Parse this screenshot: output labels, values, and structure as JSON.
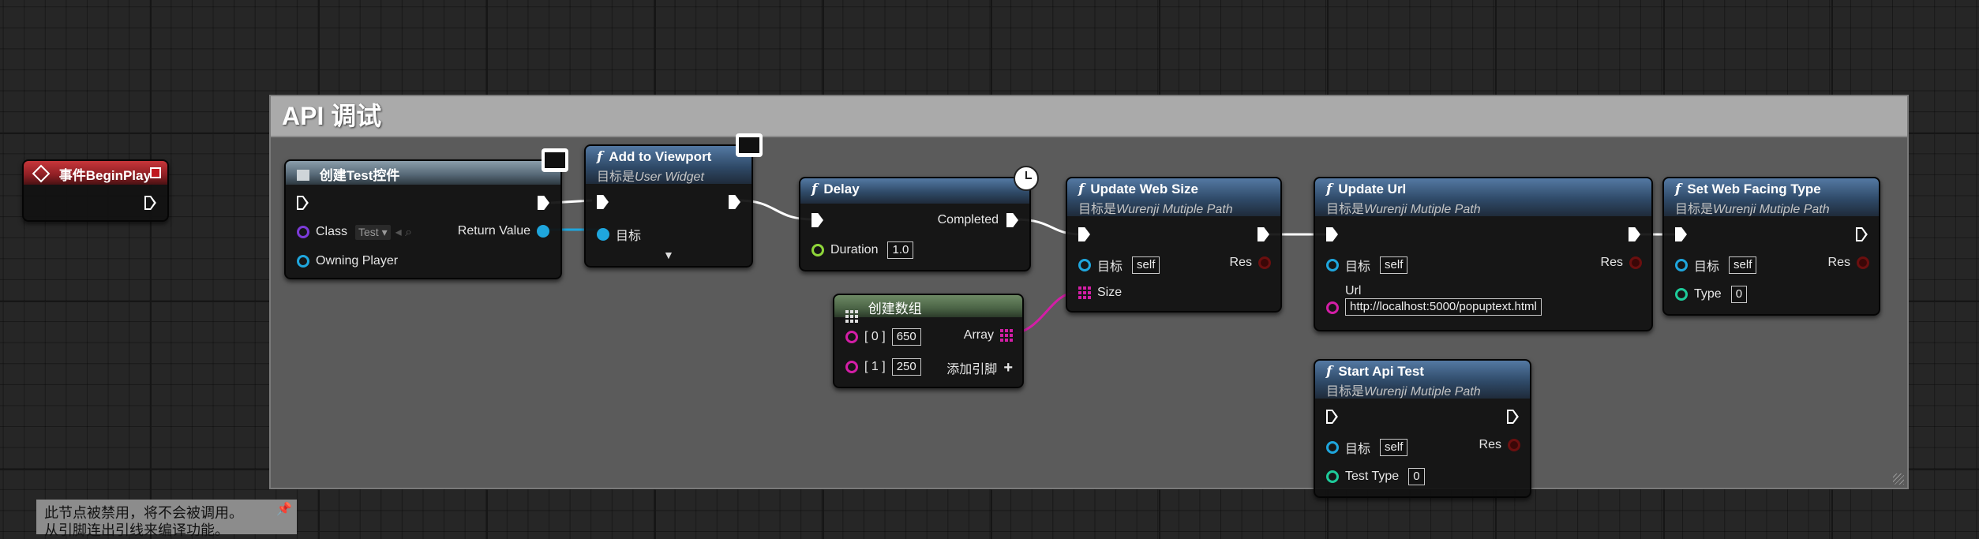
{
  "comment": {
    "title": "API 调试"
  },
  "event_begin_play": {
    "title": "事件BeginPlay"
  },
  "create_widget": {
    "title": "创建Test控件",
    "class_label": "Class",
    "class_value": "Test",
    "return_label": "Return Value",
    "owning_label": "Owning Player"
  },
  "add_to_viewport": {
    "title": "Add to Viewport",
    "subtitle_prefix": "目标是",
    "subtitle_target": "User Widget",
    "target_label": "目标"
  },
  "delay": {
    "title": "Delay",
    "completed_label": "Completed",
    "duration_label": "Duration",
    "duration_value": "1.0"
  },
  "make_array": {
    "title": "创建数组",
    "item0_label": "[ 0 ]",
    "item0_value": "650",
    "item1_label": "[ 1 ]",
    "item1_value": "250",
    "array_label": "Array",
    "add_pin_label": "添加引脚"
  },
  "update_web_size": {
    "title": "Update Web Size",
    "subtitle_prefix": "目标是",
    "subtitle_target": "Wurenji Mutiple Path",
    "target_label": "目标",
    "target_value": "self",
    "res_label": "Res",
    "size_label": "Size"
  },
  "update_url": {
    "title": "Update Url",
    "subtitle_prefix": "目标是",
    "subtitle_target": "Wurenji Mutiple Path",
    "target_label": "目标",
    "target_value": "self",
    "res_label": "Res",
    "url_label": "Url",
    "url_value": "http://localhost:5000/popuptext.html"
  },
  "set_web_facing_type": {
    "title": "Set Web Facing Type",
    "subtitle_prefix": "目标是",
    "subtitle_target": "Wurenji Mutiple Path",
    "target_label": "目标",
    "target_value": "self",
    "res_label": "Res",
    "type_label": "Type",
    "type_value": "0"
  },
  "start_api_test": {
    "title": "Start Api Test",
    "subtitle_prefix": "目标是",
    "subtitle_target": "Wurenji Mutiple Path",
    "target_label": "目标",
    "target_value": "self",
    "res_label": "Res",
    "test_type_label": "Test Type",
    "test_type_value": "0"
  },
  "disabled_note": {
    "line1": "此节点被禁用，将不会被调用。",
    "line2": "从引脚连出引线来编译功能。"
  },
  "colors": {
    "exec_wire": "#ffffff",
    "object_wire": "#1fa6dd",
    "array_wire": "#d31ea6",
    "function_header": "#3b5a80",
    "event_header": "#a32a2f"
  }
}
